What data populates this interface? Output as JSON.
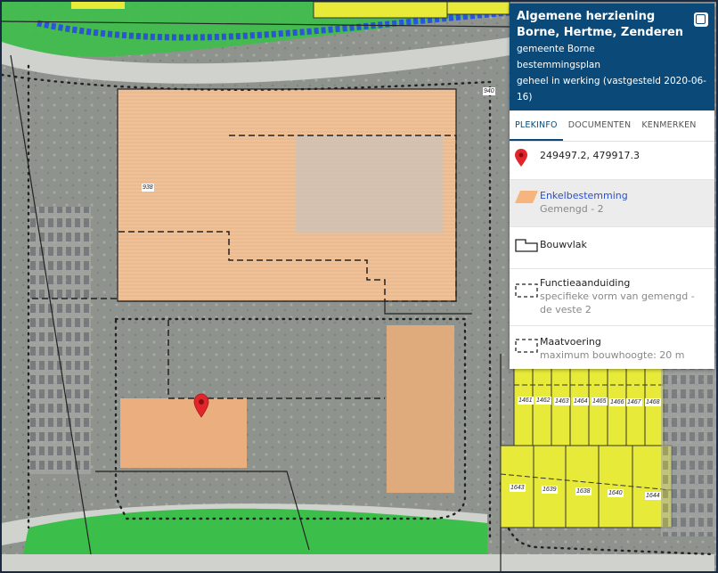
{
  "panel": {
    "title": "Algemene herziening Borne, Hertme, Zenderen",
    "municipality": "gemeente Borne",
    "plan_type": "bestemmingsplan",
    "status": "geheel in werking (vastgesteld 2020-06-16)",
    "tabs": [
      {
        "label": "PLEKINFO",
        "active": true
      },
      {
        "label": "DOCUMENTEN",
        "active": false
      },
      {
        "label": "KENMERKEN",
        "active": false
      }
    ],
    "coordinates": "249497.2, 479917.3",
    "items": {
      "enkelbestemming": {
        "title": "Enkelbestemming",
        "value": "Gemengd - 2"
      },
      "bouwvlak": {
        "title": "Bouwvlak"
      },
      "functieaanduiding": {
        "title": "Functieaanduiding",
        "value": "specifieke vorm van gemengd - de veste 2"
      },
      "maatvoering": {
        "title": "Maatvoering",
        "value": "maximum bouwhoogte: 20 m"
      }
    }
  },
  "map": {
    "parcel_numbers": [
      "940",
      "938",
      "1461",
      "1462",
      "1463",
      "1464",
      "1465",
      "1466",
      "1467",
      "1468",
      "1643",
      "1639",
      "1638",
      "1640",
      "1644"
    ],
    "colors": {
      "mixed_use": "#f6b47e",
      "residential": "#e8ea3a",
      "green": "#3cbf4a",
      "water": "#2a55d6",
      "marker": "#e0262b",
      "header": "#0b4a78"
    }
  },
  "icons": [
    "map-pin-icon",
    "close-icon",
    "hatched-area-icon",
    "building-plane-icon",
    "dashed-rect-icon"
  ]
}
